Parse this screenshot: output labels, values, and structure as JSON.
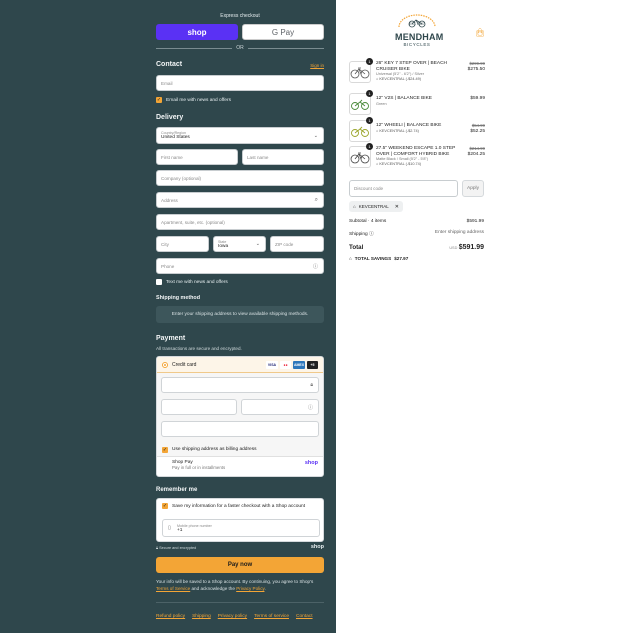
{
  "express": {
    "title": "Express checkout",
    "shop_label": "shop",
    "gpay_label": "G Pay",
    "or": "OR"
  },
  "contact": {
    "heading": "Contact",
    "signin": "Sign in",
    "email_placeholder": "Email",
    "email_news": "Email me with news and offers"
  },
  "delivery": {
    "heading": "Delivery",
    "country_label": "Country/Region",
    "country_value": "United States",
    "first_name": "First name",
    "last_name": "Last name",
    "company": "Company (optional)",
    "address": "Address",
    "apartment": "Apartment, suite, etc. (optional)",
    "city": "City",
    "state_label": "State",
    "state_value": "Iowa",
    "zip": "ZIP code",
    "phone": "Phone",
    "text_news": "Text me with news and offers"
  },
  "shipping": {
    "heading": "Shipping method",
    "message": "Enter your shipping address to view available shipping methods."
  },
  "payment": {
    "heading": "Payment",
    "subtitle": "All transactions are secure and encrypted.",
    "credit_card": "Credit card",
    "cards": [
      "VISA",
      "MC",
      "AMEX",
      "+5"
    ],
    "card_colors": [
      "#1a1f71",
      "#eb001b",
      "#2e77bb",
      "#222222"
    ],
    "billing": "Use shipping address as billing address",
    "shoppay": "Shop Pay",
    "shoppay_sub": "Pay in full or in installments",
    "shoppay_logo": "shop"
  },
  "remember": {
    "heading": "Remember me",
    "save": "Save my information for a faster checkout with a Shop account",
    "mobile_label": "Mobile phone number",
    "mobile_value": "+1",
    "secure": "Secure and encrypted",
    "shop_logo": "shop"
  },
  "paynow": "Pay now",
  "legal": {
    "text1": "Your info will be saved to a Shop account. By continuing, you agree to Shop's",
    "terms": "Terms of Service",
    "and": "and acknowledge the",
    "privacy": "Privacy Policy",
    "end": "."
  },
  "footer": [
    "Refund policy",
    "Shipping",
    "Privacy policy",
    "Terms of service",
    "Contact"
  ],
  "brand": {
    "top": "EST. 2007",
    "name": "MENDHAM",
    "sub": "BICYCLES"
  },
  "items": [
    {
      "qty": "1",
      "title": "26\" KEY 7 STEP OVER | BEACH CRUISER BIKE",
      "sub": "Universal (5'2\" - 6'2\") / Silver",
      "disc": "KEVCENTRAL (-$24.49)",
      "old": "$299.99",
      "price": "$275.50"
    },
    {
      "qty": "1",
      "title": "12\" V2S | BALANCE BIKE",
      "sub": "Green",
      "disc": "",
      "old": "",
      "price": "$59.99"
    },
    {
      "qty": "1",
      "title": "12\" WHEELI | BALANCE BIKE",
      "sub": "",
      "disc": "KEVCENTRAL (-$2.74)",
      "old": "$54.99",
      "price": "$52.25"
    },
    {
      "qty": "1",
      "title": "27.5\" WEEKEND ESCAPE 1.0 STEP OVER | COMFORT HYBRID BIKE",
      "sub": "Matte Black / Small (5'2\" - 5'8\")",
      "disc": "KEVCENTRAL (-$10.74)",
      "old": "$214.99",
      "price": "$204.25"
    }
  ],
  "discount": {
    "placeholder": "Discount code",
    "apply": "Apply",
    "tag": "KEVCENTRAL"
  },
  "summary": {
    "subtotal_label": "Subtotal · 4 items",
    "subtotal": "$591.99",
    "shipping_label": "Shipping",
    "shipping": "Enter shipping address",
    "total_label": "Total",
    "currency": "USD",
    "total": "$591.99",
    "savings_label": "TOTAL SAVINGS",
    "savings": "$27.97"
  }
}
